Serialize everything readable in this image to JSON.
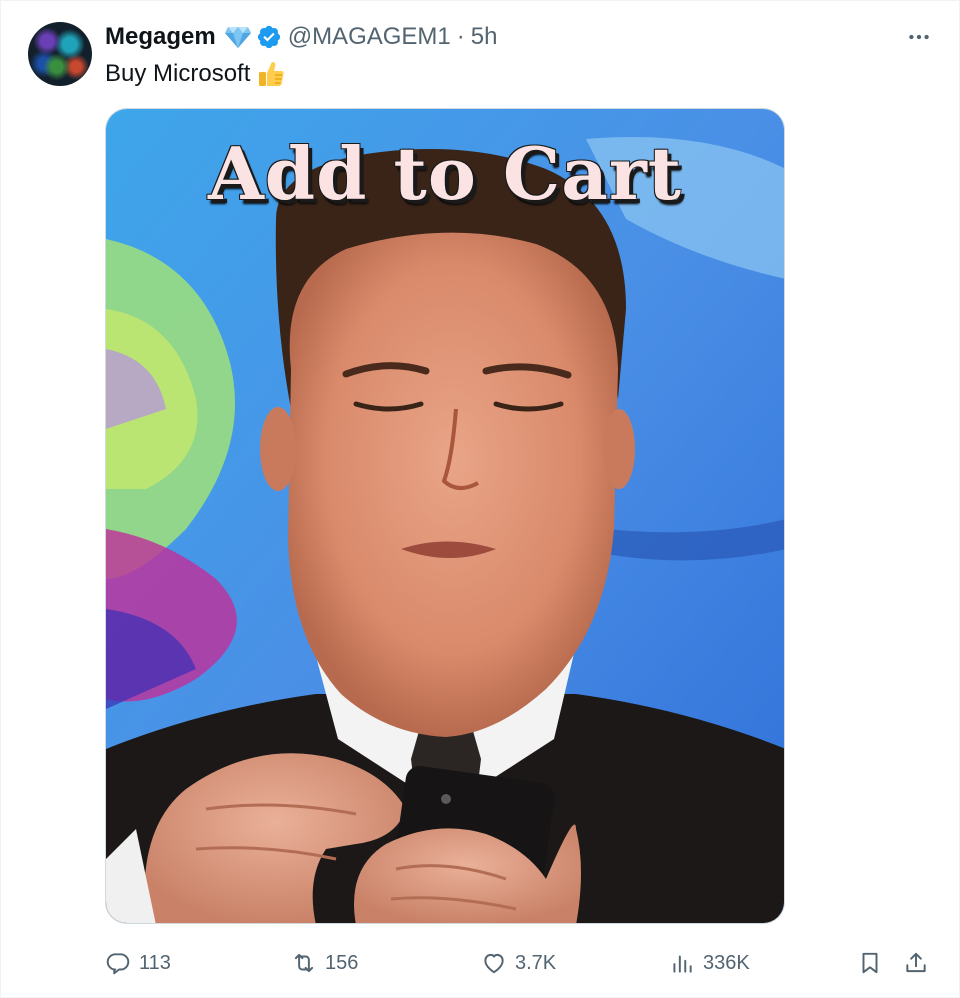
{
  "author": {
    "name": "Megagem",
    "handle": "@MAGAGEM1",
    "separator": "·",
    "time": "5h",
    "badges": [
      "diamond-icon",
      "verified-badge-icon"
    ]
  },
  "tweet": {
    "text": "Buy Microsoft",
    "emoji": "thumbs-up-icon"
  },
  "media": {
    "overlay_text": "Add to Cart"
  },
  "actions": {
    "replies": "113",
    "reposts": "156",
    "likes": "3.7K",
    "views": "336K"
  },
  "colors": {
    "accent": "#1d9bf0",
    "secondary_text": "#536471"
  }
}
